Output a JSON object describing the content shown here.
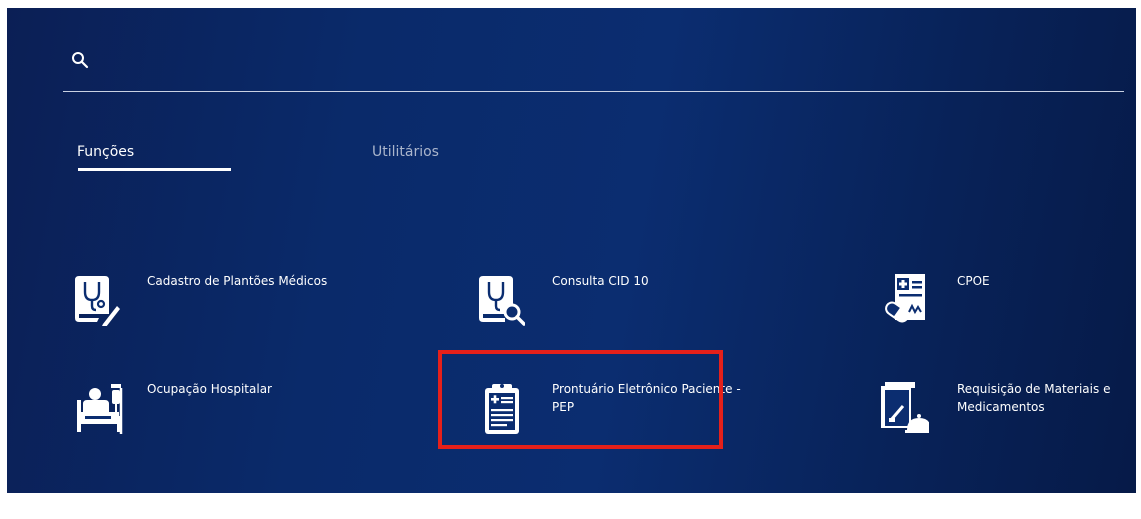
{
  "search": {
    "placeholder": ""
  },
  "tabs": [
    {
      "label": "Funções",
      "active": true
    },
    {
      "label": "Utilitários",
      "active": false
    }
  ],
  "functions": [
    {
      "label": "Cadastro de Plantões Médicos",
      "icon": "stethoscope-pencil-icon"
    },
    {
      "label": "Consulta CID 10",
      "icon": "stethoscope-magnifier-icon"
    },
    {
      "label": "CPOE",
      "icon": "prescription-pill-icon"
    },
    {
      "label": "Ocupação Hospitalar",
      "icon": "hospital-bed-icon"
    },
    {
      "label": "Prontuário Eletrônico Paciente - PEP",
      "icon": "medical-clipboard-icon"
    },
    {
      "label": "Requisição de Materiais e Medicamentos",
      "icon": "supply-bell-icon"
    }
  ],
  "colors": {
    "background": "#0a2a6a",
    "text": "#ffffff",
    "inactive_tab": "#aab5cc",
    "highlight": "#e5201a"
  }
}
